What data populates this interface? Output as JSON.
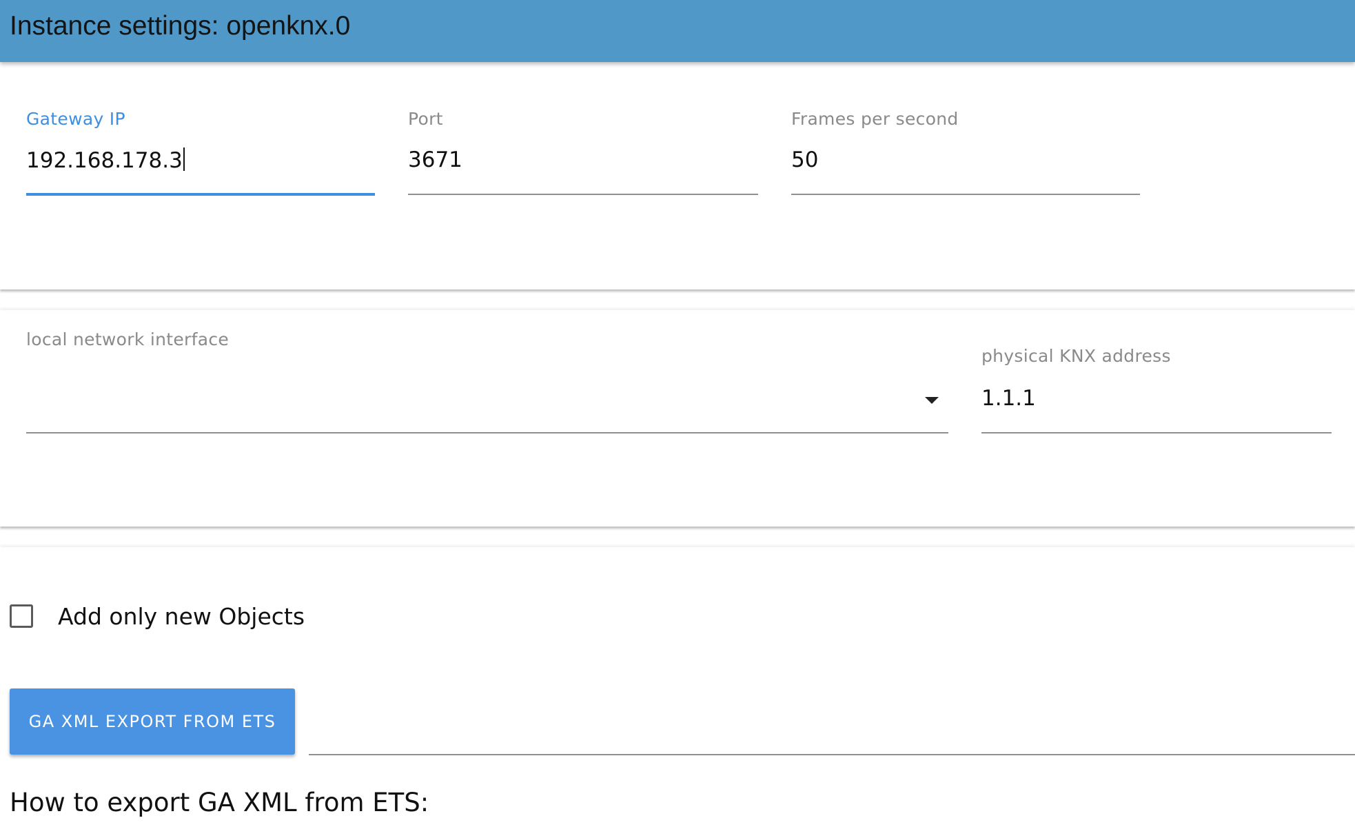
{
  "header": {
    "title": "Instance settings: openknx.0"
  },
  "connection": {
    "gateway_ip": {
      "label": "Gateway IP",
      "value": "192.168.178.3"
    },
    "port": {
      "label": "Port",
      "value": "3671"
    },
    "fps": {
      "label": "Frames per second",
      "value": "50"
    }
  },
  "network": {
    "interface": {
      "label": "local network interface",
      "value": ""
    },
    "knx_address": {
      "label": "physical KNX address",
      "value": "1.1.1"
    }
  },
  "import": {
    "add_only_new": {
      "label": "Add only new Objects",
      "checked": false
    },
    "export_button": "GA XML EXPORT FROM ETS",
    "howto_heading": "How to export GA XML from ETS:"
  },
  "colors": {
    "header_bg": "#4f98c8",
    "accent": "#4a92e2",
    "focused_field": "#3f8fe0"
  }
}
